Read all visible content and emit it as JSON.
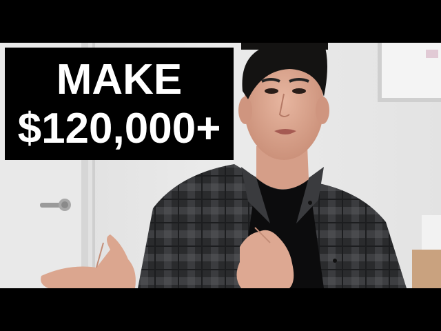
{
  "thumbnail": {
    "headline": {
      "line1": "MAKE",
      "line2": "$120,000+"
    }
  },
  "colors": {
    "wall": "#e4e4e4",
    "text": "#ffffff",
    "text_box": "#000000",
    "shirt": "#2b2c2e"
  }
}
